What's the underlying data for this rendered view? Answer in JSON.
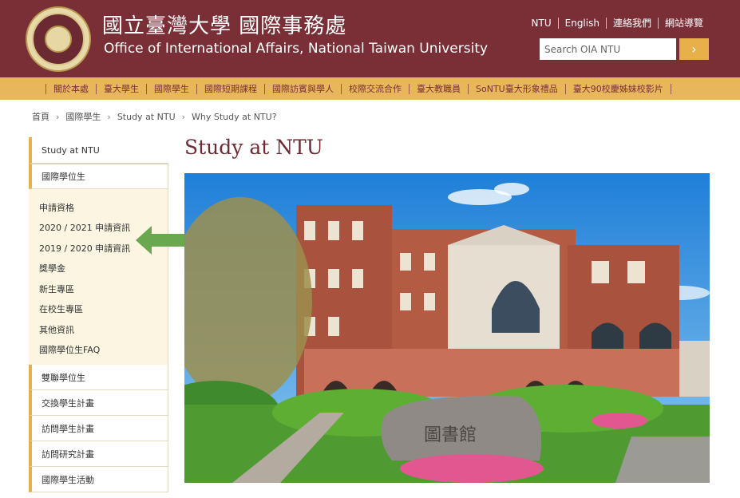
{
  "header": {
    "title_cn": "國立臺灣大學 國際事務處",
    "title_en": "Office of International Affairs, National Taiwan University",
    "toplinks": [
      "NTU",
      "English",
      "連絡我們",
      "網站導覽"
    ],
    "search_placeholder": "Search OIA NTU",
    "search_button": "›"
  },
  "nav": {
    "items": [
      "關於本處",
      "臺大學生",
      "國際學生",
      "國際短期課程",
      "國際訪賓與學人",
      "校際交流合作",
      "臺大教職員",
      "SoNTU臺大形象禮品",
      "臺大90校慶姊妹校影片"
    ]
  },
  "breadcrumb": [
    "首頁",
    "國際學生",
    "Study at NTU",
    "Why Study at NTU?"
  ],
  "sidebar": {
    "top": "Study at NTU",
    "active": "國際學位生",
    "sub": [
      "申請資格",
      "2020 / 2021 申請資訊",
      "2019 / 2020 申請資訊",
      "獎學金",
      "新生專區",
      "在校生專區",
      "其他資訊",
      "國際學位生FAQ"
    ],
    "items": [
      "雙聯學位生",
      "交換學生計畫",
      "訪問學生計畫",
      "訪問研究計畫",
      "國際學生活動"
    ]
  },
  "main": {
    "title": "Study at NTU",
    "hero_sign": "圖書館"
  },
  "colors": {
    "brand": "#7a2e36",
    "accent": "#e8b04b",
    "arrow": "#6aa84f"
  }
}
